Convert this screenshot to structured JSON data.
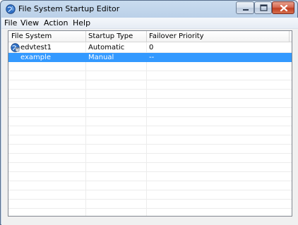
{
  "window": {
    "title": "File System Startup Editor",
    "icon": "app-globe-icon"
  },
  "titlebar_buttons": {
    "minimize": "minimize-icon",
    "maximize": "maximize-icon",
    "close": "close-icon"
  },
  "menu": {
    "items": [
      "File",
      "View",
      "Action",
      "Help"
    ]
  },
  "list": {
    "columns": [
      "File System",
      "Startup Type",
      "Failover Priority"
    ],
    "rows": [
      {
        "name": "edvtest1",
        "startup_type": "Automatic",
        "failover_priority": "0",
        "icon": "server-node-icon",
        "selected": false
      },
      {
        "name": "example",
        "startup_type": "Manual",
        "failover_priority": "--",
        "icon": "",
        "selected": true
      }
    ]
  },
  "colors": {
    "selection": "#3399ff",
    "close_button": "#c8432a"
  }
}
